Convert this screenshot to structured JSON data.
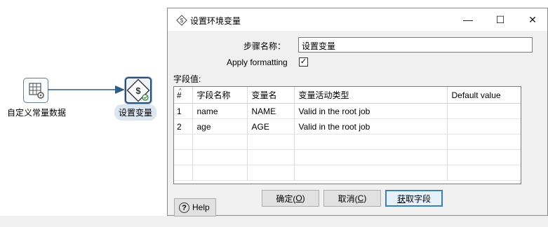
{
  "canvas": {
    "steps": [
      {
        "label": "自定义常量数据",
        "icon": "table-gear-icon"
      },
      {
        "label": "设置变量",
        "icon": "set-variable-icon"
      }
    ]
  },
  "dialog": {
    "title": "设置环境变量",
    "window_buttons": {
      "minimize": "—",
      "maximize": "☐",
      "close": "✕"
    },
    "step_name_label": "步骤名称：",
    "step_name_value": "设置变量",
    "apply_formatting_label": "Apply formatting",
    "apply_formatting_checked": true,
    "fields_label": "字段值:",
    "table": {
      "columns": [
        "#",
        "字段名称",
        "变量名",
        "变量活动类型",
        "Default value"
      ],
      "rows": [
        [
          "1",
          "name",
          "NAME",
          "Valid in the root job",
          ""
        ],
        [
          "2",
          "age",
          "AGE",
          "Valid in the root job",
          ""
        ]
      ]
    },
    "buttons": {
      "ok_text": "确定(",
      "ok_key": "O",
      "ok_end": ")",
      "cancel_text": "取消(",
      "cancel_key": "C",
      "cancel_end": ")",
      "get_fields_key": "获",
      "get_fields_rest": "取字段",
      "help": "Help"
    }
  }
}
